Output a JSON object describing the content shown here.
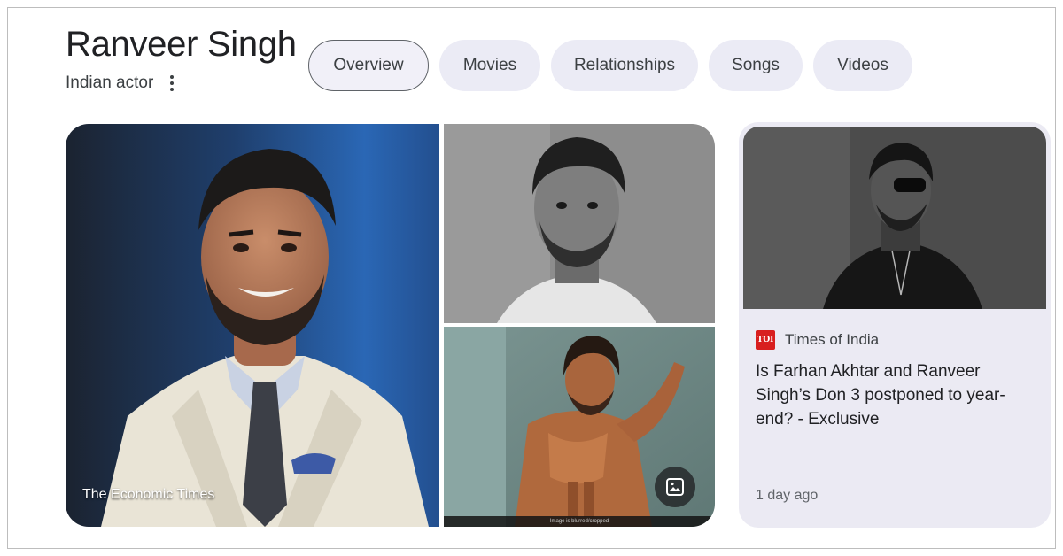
{
  "entity": {
    "title": "Ranveer Singh",
    "subtitle": "Indian actor",
    "more_icon": "more-vert-icon"
  },
  "tabs": [
    {
      "label": "Overview",
      "active": true
    },
    {
      "label": "Movies",
      "active": false
    },
    {
      "label": "Relationships",
      "active": false
    },
    {
      "label": "Songs",
      "active": false
    },
    {
      "label": "Videos",
      "active": false
    }
  ],
  "gallery": {
    "main_source": "The Economic Times",
    "photo_icon": "image-icon"
  },
  "news": {
    "source": "Times of India",
    "source_logo_text": "TOI",
    "headline": "Is Farhan Akhtar and Ranveer Singh’s Don 3 postponed to year-end? - Exclusive",
    "time": "1 day ago"
  },
  "colors": {
    "tab_bg": "#ebebf5",
    "card_bg": "#ebeaf3",
    "toi_red": "#d81e1e",
    "text": "#202124"
  }
}
